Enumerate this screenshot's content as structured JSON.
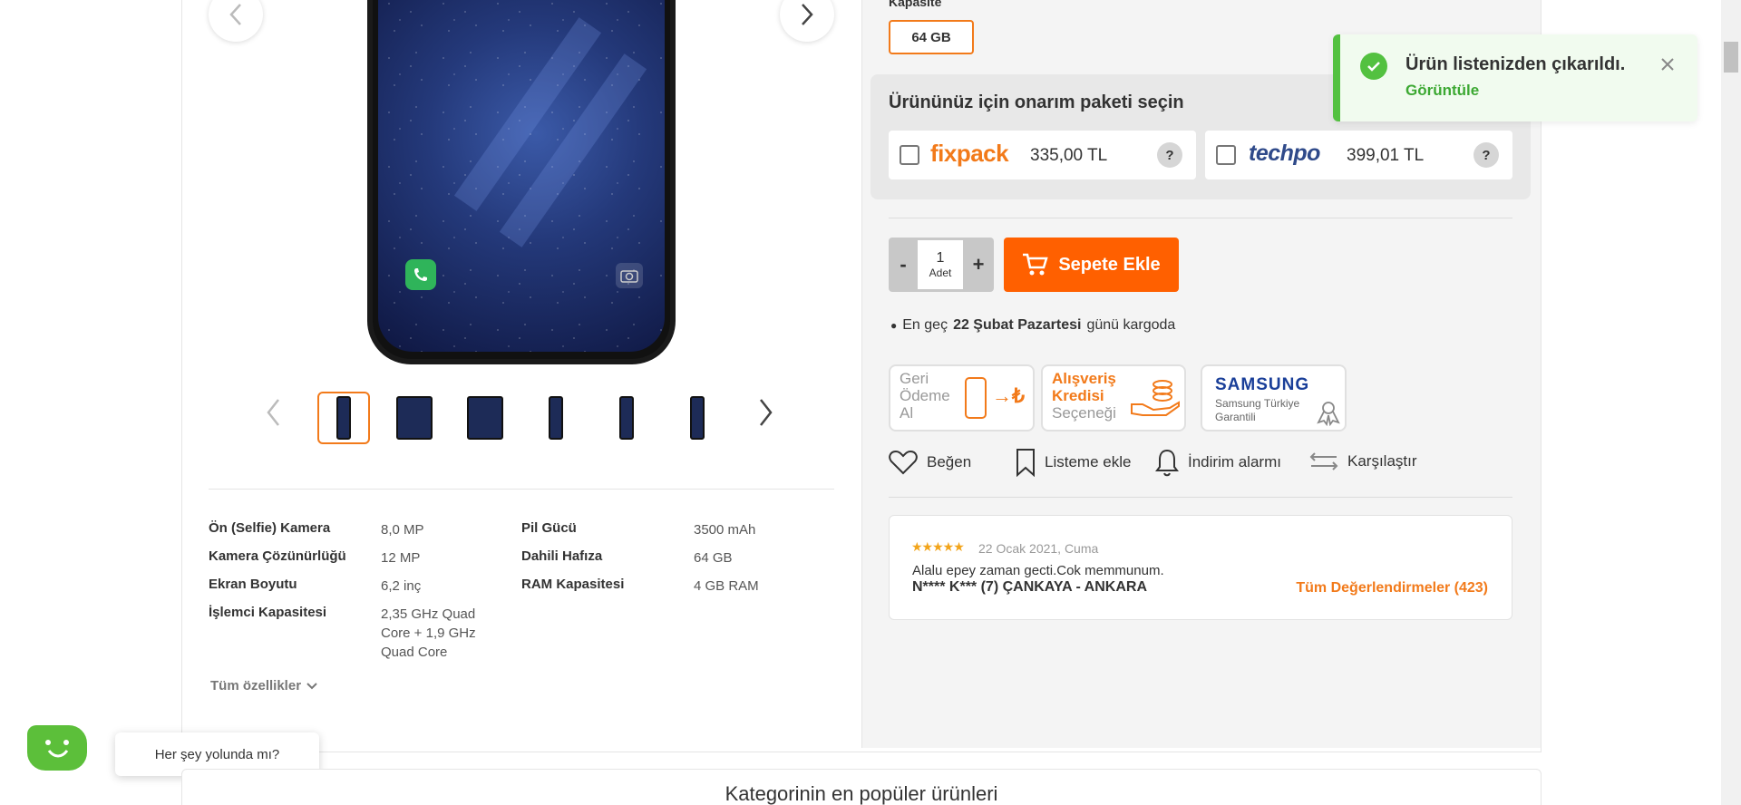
{
  "capacity": {
    "label": "Kapasite",
    "selected": "64 GB"
  },
  "repair": {
    "title": "Ürününüz için onarım paketi seçin",
    "packages": [
      {
        "brand": "fixpack",
        "price": "335,00 TL",
        "help": "?"
      },
      {
        "brand": "techpo",
        "price": "399,01 TL",
        "help": "?"
      }
    ]
  },
  "quantity": {
    "minus": "-",
    "value": "1",
    "unit": "Adet",
    "plus": "+"
  },
  "cart": {
    "label": "Sepete Ekle"
  },
  "delivery": {
    "prefix": "En geç",
    "date": "22 Şubat Pazartesi",
    "suffix": "günü kargoda"
  },
  "badges": {
    "cashback": {
      "line1": "Geri",
      "line2": "Ödeme",
      "line3": "Al",
      "symbol": "→₺"
    },
    "credit": {
      "line1": "Alışveriş",
      "line2": "Kredisi",
      "line3": "Seçeneği"
    },
    "samsung": {
      "brand": "SAMSUNG",
      "line1": "Samsung Türkiye",
      "line2": "Garantili"
    }
  },
  "actions": {
    "like": "Beğen",
    "list": "Listeme ekle",
    "alarm": "İndirim alarmı",
    "compare": "Karşılaştır"
  },
  "review": {
    "stars": "★★★★★",
    "date": "22 Ocak 2021, Cuma",
    "text": "Alalu epey zaman gecti.Cok memmunum.",
    "author": "N**** K*** (7) ÇANKAYA - ANKARA",
    "all_link": "Tüm Değerlendirmeler (423)"
  },
  "specs": {
    "left": [
      {
        "label": "Ön (Selfie) Kamera",
        "value": "8,0 MP"
      },
      {
        "label": "Kamera Çözünürlüğü",
        "value": "12 MP"
      },
      {
        "label": "Ekran Boyutu",
        "value": "6,2 inç"
      },
      {
        "label": "İşlemci Kapasitesi",
        "value": "2,35 GHz Quad Core + 1,9 GHz Quad Core"
      }
    ],
    "right": [
      {
        "label": "Pil Gücü",
        "value": "3500 mAh"
      },
      {
        "label": "Dahili Hafıza",
        "value": "64 GB"
      },
      {
        "label": "RAM Kapasitesi",
        "value": "4 GB RAM"
      }
    ],
    "all_link": "Tüm özellikler"
  },
  "toast": {
    "message": "Ürün listenizden çıkarıldı.",
    "action": "Görüntüle"
  },
  "chat": {
    "bubble": "Her şey yolunda mı?"
  },
  "popular": {
    "title": "Kategorinin en popüler ürünleri"
  },
  "colors": {
    "accent": "#f27a1a",
    "cart": "#ff6000",
    "success": "#53c140",
    "link": "#f27a1a"
  }
}
